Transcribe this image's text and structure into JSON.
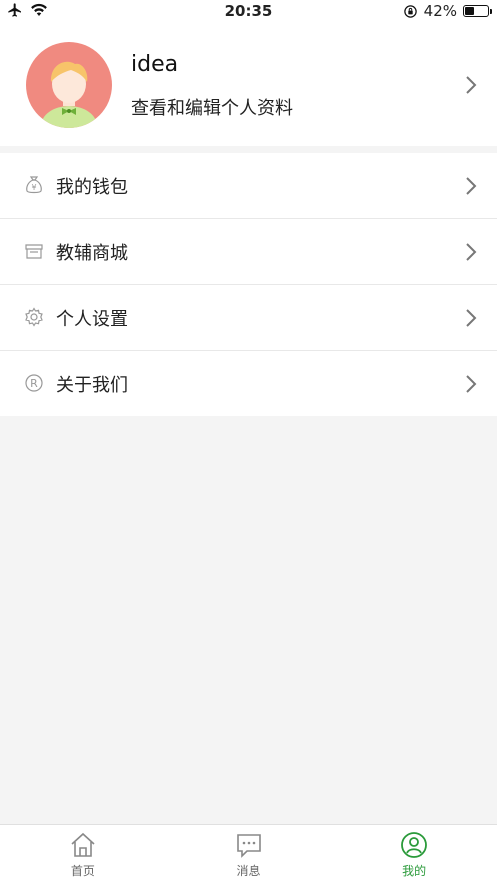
{
  "status_bar": {
    "time": "20:35",
    "battery_percent": "42%",
    "battery_level": 0.42,
    "icons": [
      "airplane-icon",
      "wifi-icon",
      "orientation-lock-icon",
      "battery-icon"
    ]
  },
  "profile": {
    "name": "idea",
    "subtitle": "查看和编辑个人资料",
    "avatar_icon": "avatar-illustration"
  },
  "menu": {
    "items": [
      {
        "label": "我的钱包",
        "icon": "wallet-bag-icon"
      },
      {
        "label": "教辅商城",
        "icon": "store-icon"
      },
      {
        "label": "个人设置",
        "icon": "gear-icon"
      },
      {
        "label": "关于我们",
        "icon": "registered-icon"
      }
    ]
  },
  "tabbar": {
    "active_color": "#2a9a3a",
    "tabs": [
      {
        "label": "首页",
        "icon": "home-icon",
        "active": false
      },
      {
        "label": "消息",
        "icon": "message-icon",
        "active": false
      },
      {
        "label": "我的",
        "icon": "user-icon",
        "active": true
      }
    ]
  }
}
